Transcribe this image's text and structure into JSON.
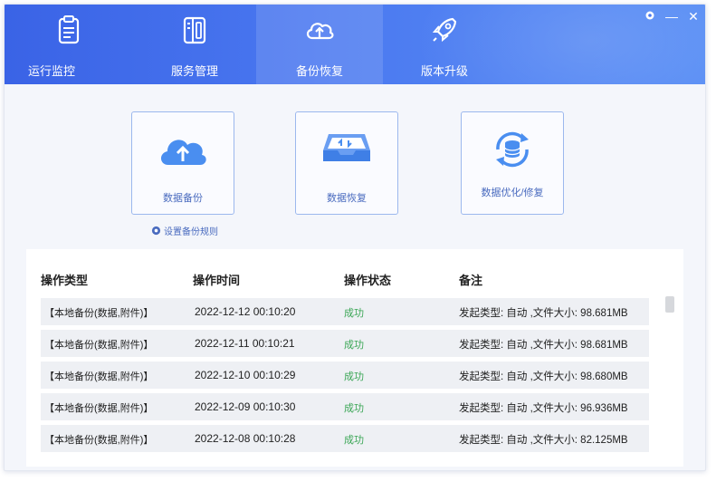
{
  "tabs": [
    {
      "label": "运行监控",
      "icon": "clipboard-icon"
    },
    {
      "label": "服务管理",
      "icon": "server-icon"
    },
    {
      "label": "备份恢复",
      "icon": "cloud-upload-icon",
      "active": true
    },
    {
      "label": "版本升级",
      "icon": "rocket-icon"
    }
  ],
  "actions": {
    "backup_label": "数据备份",
    "restore_label": "数据恢复",
    "optimize_label": "数据优化/修复",
    "rule_link": "设置备份规则"
  },
  "table": {
    "headers": [
      "操作类型",
      "操作时间",
      "操作状态",
      "备注"
    ],
    "rows": [
      {
        "type": "【本地备份(数据,附件)】",
        "time": "2022-12-12 00:10:20",
        "status": "成功",
        "note": "发起类型: 自动 ,文件大小: 98.681MB"
      },
      {
        "type": "【本地备份(数据,附件)】",
        "time": "2022-12-11 00:10:21",
        "status": "成功",
        "note": "发起类型: 自动 ,文件大小: 98.681MB"
      },
      {
        "type": "【本地备份(数据,附件)】",
        "time": "2022-12-10 00:10:29",
        "status": "成功",
        "note": "发起类型: 自动 ,文件大小: 98.680MB"
      },
      {
        "type": "【本地备份(数据,附件)】",
        "time": "2022-12-09 00:10:30",
        "status": "成功",
        "note": "发起类型: 自动 ,文件大小: 96.936MB"
      },
      {
        "type": "【本地备份(数据,附件)】",
        "time": "2022-12-08 00:10:28",
        "status": "成功",
        "note": "发起类型: 自动 ,文件大小: 82.125MB"
      }
    ]
  },
  "colors": {
    "header": "#4a78f0",
    "accent": "#4a6bbf",
    "success": "#3aa655",
    "row_bg": "#eef0f4"
  }
}
